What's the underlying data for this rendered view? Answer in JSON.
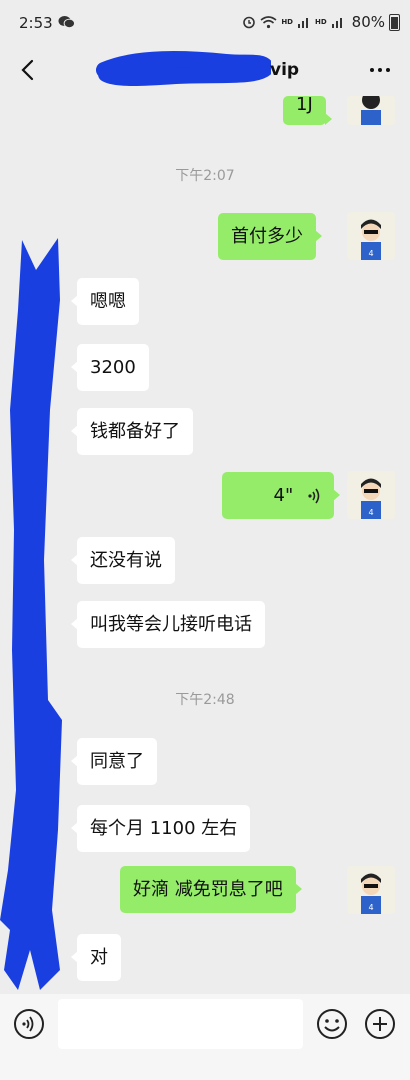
{
  "status_bar": {
    "time": "2:53",
    "hd1": "HD",
    "hd2": "HD",
    "battery": "80%"
  },
  "header": {
    "title_suffix": "vip",
    "back_icon": "chevron-left-icon",
    "more_icon": "more-dots-icon"
  },
  "messages": {
    "partial_out_text": "1J",
    "time_1": "下午2:07",
    "out_1": "首付多少",
    "in_1": "嗯嗯",
    "in_2": "3200",
    "in_3": "钱都备好了",
    "voice_out_duration": "4\"",
    "in_4": "还没有说",
    "in_5": "叫我等会儿接听电话",
    "time_2": "下午2:48",
    "in_6": "同意了",
    "in_7": "每个月 1100 左右",
    "out_2": "好滴  减免罚息了吧",
    "in_8": "对"
  },
  "input_bar": {
    "voice_icon": "voice-toggle-icon",
    "emoji_icon": "emoji-icon",
    "plus_icon": "plus-icon"
  },
  "colors": {
    "background": "#ededed",
    "bubble_out": "#95ec69",
    "bubble_in": "#ffffff",
    "redaction": "#1a3fe0"
  }
}
